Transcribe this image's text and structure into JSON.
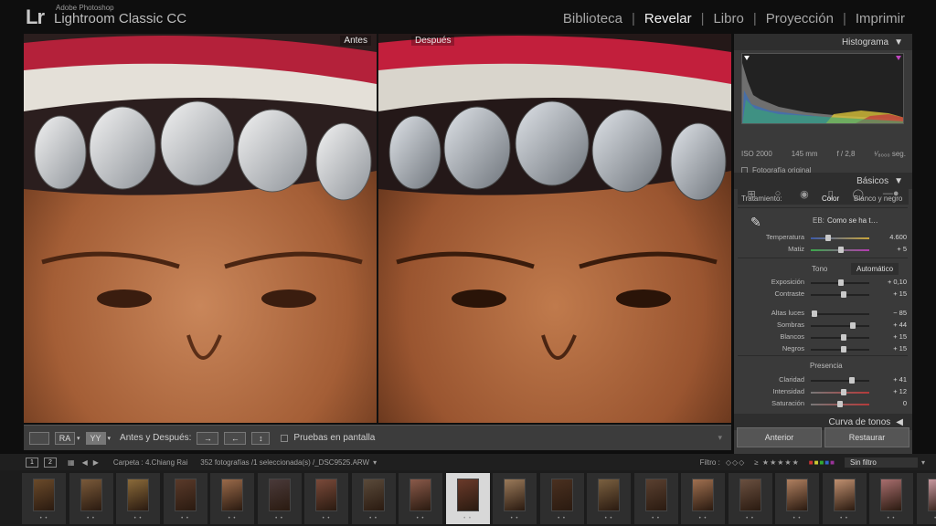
{
  "app": {
    "brand_small": "Adobe Photoshop",
    "brand_name": "Lightroom Classic CC",
    "logo": "Lr"
  },
  "modules": [
    "Biblioteca",
    "Revelar",
    "Libro",
    "Proyección",
    "Imprimir"
  ],
  "active_module": "Revelar",
  "compare": {
    "before_label": "Antes",
    "after_label": "Después"
  },
  "toolbar": {
    "view_ra": "RA",
    "view_yy": "YY",
    "before_after_label": "Antes y Después:",
    "softproof_label": "Pruebas en pantalla"
  },
  "panel": {
    "histogram_title": "Histograma",
    "iso": "ISO 2000",
    "focal": "145 mm",
    "aperture": "f / 2,8",
    "shutter": "¹⁄₈₀₀₀ seg.",
    "original_photo": "Fotografía original",
    "basic_title": "Básicos",
    "treatment_label": "Tratamiento:",
    "treatment_color": "Color",
    "treatment_bw": "Blanco y negro",
    "wb_label": "EB:",
    "wb_value": "Como se ha t…",
    "tone_label": "Tono",
    "auto_label": "Automático",
    "presence_label": "Presencia",
    "curve_title": "Curva de tonos",
    "prev_button": "Anterior",
    "reset_button": "Restaurar",
    "sliders": [
      {
        "label": "Temperatura",
        "value": "4.600",
        "pos": 0.3
      },
      {
        "label": "Matiz",
        "value": "+ 5",
        "pos": 0.52
      },
      {
        "label": "Exposición",
        "value": "+ 0,10",
        "pos": 0.52
      },
      {
        "label": "Contraste",
        "value": "+ 15",
        "pos": 0.57
      },
      {
        "label": "Altas luces",
        "value": "− 85",
        "pos": 0.07
      },
      {
        "label": "Sombras",
        "value": "+ 44",
        "pos": 0.72
      },
      {
        "label": "Blancos",
        "value": "+ 15",
        "pos": 0.57
      },
      {
        "label": "Negros",
        "value": "+ 15",
        "pos": 0.57
      },
      {
        "label": "Claridad",
        "value": "+ 41",
        "pos": 0.7
      },
      {
        "label": "Intensidad",
        "value": "+ 12",
        "pos": 0.56
      },
      {
        "label": "Saturación",
        "value": "0",
        "pos": 0.5
      }
    ]
  },
  "filmbar": {
    "page1": "1",
    "page2": "2",
    "folder": "Carpeta : 4.Chiang Rai",
    "count": "352 fotografías /1 seleccionada(s) /_DSC9525.ARW",
    "filter_label": "Filtro :",
    "filter_value": "Sin filtro"
  },
  "colors": {
    "accent": "#d8d8d8",
    "panel_bg": "#3a3a3a",
    "header_bg": "#2e2e2e"
  }
}
